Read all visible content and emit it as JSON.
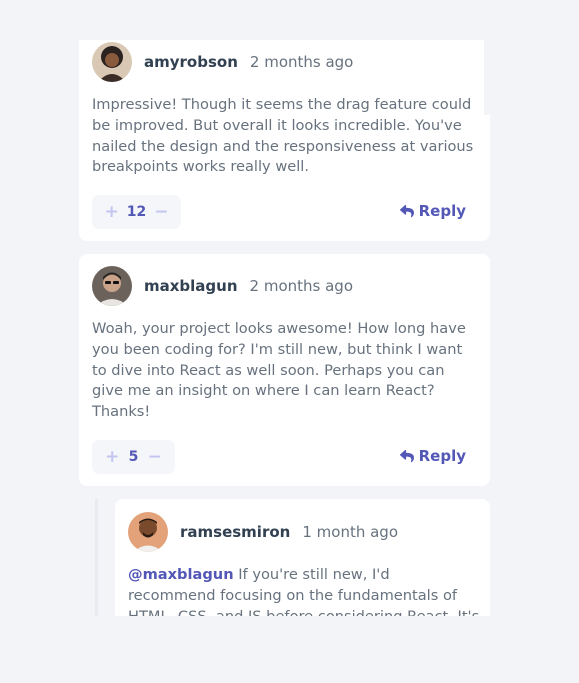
{
  "comments": [
    {
      "username": "amyrobson",
      "date": "2 months ago",
      "body": "Impressive! Though it seems the drag feature could be improved. But overall it looks incredible. You've nailed the design and the responsiveness at various breakpoints works really well.",
      "score": "12",
      "plus": "+",
      "minus": "−",
      "reply_label": "Reply"
    },
    {
      "username": "maxblagun",
      "date": "2 months ago",
      "body": "Woah, your project looks awesome! How long have you been coding for? I'm still new, but think I want to dive into React as well soon. Perhaps you can give me an insight on where I can learn React? Thanks!",
      "score": "5",
      "plus": "+",
      "minus": "−",
      "reply_label": "Reply"
    }
  ],
  "replies": [
    {
      "username": "ramsesmiron",
      "date": "1 month ago",
      "mention": "@maxblagun",
      "body": " If you're still new, I'd recommend focusing on the fundamentals of HTML, CSS, and JS before considering React. It's very"
    }
  ],
  "colors": {
    "accent": "#5357b6",
    "vote_icon": "#c5c6ef",
    "text": "#67727e",
    "username": "#324152",
    "background": "#f3f4f8"
  },
  "icons": {
    "reply": "reply-arrow-icon"
  }
}
